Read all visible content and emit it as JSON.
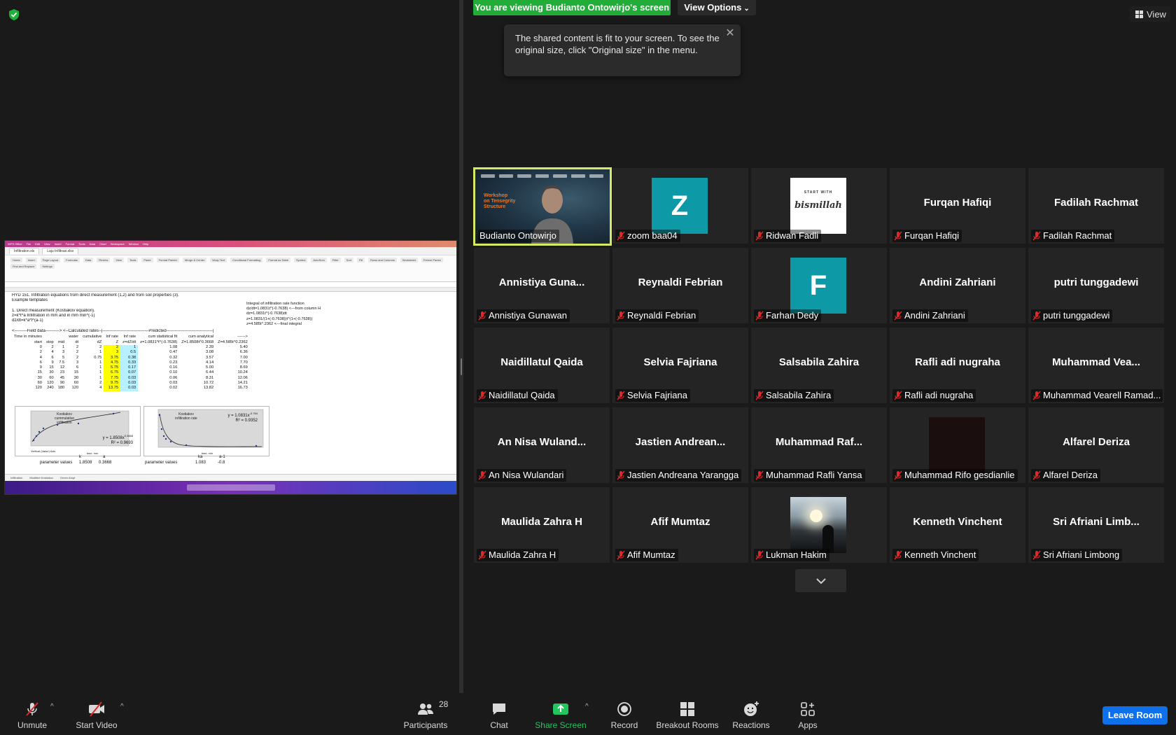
{
  "banner": {
    "viewing_text": "You are viewing Budianto Ontowirjo's screen",
    "view_options_label": "View Options"
  },
  "view_button": {
    "label": "View"
  },
  "tooltip": {
    "text": "The shared content is fit to your screen. To see the original size, click \"Original size\" in the menu."
  },
  "shared_screen": {
    "menu_items": [
      "WPS Office",
      "File",
      "Edit",
      "View",
      "Insert",
      "Format",
      "Tools",
      "Data",
      "Chart",
      "Workspace",
      "Window",
      "Help"
    ],
    "tabs": [
      "Infiltration.xls",
      "Laju Infiltrasi.xlsx"
    ],
    "ribbon_items": [
      "Home",
      "Insert",
      "Page Layout",
      "Formulas",
      "Data",
      "Review",
      "View",
      "Tools",
      "Paste",
      "Format Painter",
      "Merge & Center",
      "Wrap Text",
      "Conditional Formatting",
      "Format as Table",
      "Symbol",
      "AutoSum",
      "Filter",
      "Sort",
      "Fill",
      "Rows and Columns",
      "Worksheet",
      "Freeze Panes",
      "Find and Replace",
      "Settings"
    ],
    "lines": [
      "HYD 151. Infiltration equations from direct measurement (1,2) and from soil properties (3).",
      "Example templates",
      "",
      "1. Direct measurement (Kostiakov equation).",
      "z=k*t^a                    Infiltration in mm and in mm min^(-1)",
      "dz/dt=k*a*t^(a-1)",
      "",
      "<---------Field data---------->  <--Calculated rates--|---------------------------------Predicted---------------------------------|"
    ],
    "table_header1": [
      "Time in minutes",
      "",
      "",
      "water",
      "cumulative",
      "Inf rate",
      "Inf rate",
      "cum statistical fit",
      "cum analytical",
      "------>"
    ],
    "table_header2": [
      "start",
      "stop",
      "mid",
      "dt",
      "dZ",
      "Z",
      "z=dZ/dt",
      "z=1.0831*t^(-0.7638)",
      "Z=1.8508t^0.3668",
      "Z=4.585t^0.2362"
    ],
    "rows": [
      [
        "0",
        "2",
        "1",
        "2",
        "2",
        "2",
        "1",
        "1.08",
        "2.39",
        "5.40"
      ],
      [
        "2",
        "4",
        "3",
        "2",
        "1",
        "3",
        "0.5",
        "0.47",
        "3.08",
        "6.36"
      ],
      [
        "4",
        "6",
        "5",
        "2",
        "0.75",
        "3.75",
        "0.38",
        "0.32",
        "3.57",
        "7.00"
      ],
      [
        "6",
        "9",
        "7.5",
        "3",
        "1",
        "4.75",
        "0.33",
        "0.23",
        "4.14",
        "7.70"
      ],
      [
        "9",
        "15",
        "12",
        "6",
        "1",
        "5.75",
        "0.17",
        "0.16",
        "5.00",
        "8.69"
      ],
      [
        "15",
        "30",
        "23",
        "15",
        "1",
        "6.75",
        "0.07",
        "0.10",
        "6.44",
        "10.24"
      ],
      [
        "30",
        "60",
        "45",
        "30",
        "1",
        "7.75",
        "0.03",
        "0.06",
        "8.31",
        "12.06"
      ],
      [
        "60",
        "120",
        "90",
        "60",
        "2",
        "9.75",
        "0.03",
        "0.03",
        "10.72",
        "14.21"
      ],
      [
        "120",
        "240",
        "180",
        "120",
        "4",
        "13.75",
        "0.03",
        "0.02",
        "13.82",
        "16.73"
      ]
    ],
    "side_notes": [
      "Integral of infiltration rate function",
      "dz/dt=1.0831t^(-0.7638)  <---from column H",
      "dz=1.0831t^(-0.7638)dt",
      "z=1.0831/(1+(-0.7638))t^(1+(-0.7638))",
      "z=4.585t^.2362    <---final integral"
    ],
    "chart1": {
      "title": "Kostiakov\ncummulative\ninfiltration",
      "equation": "y = 1.8508x",
      "exponent": "0.3668",
      "r2": "R² = 0.9693",
      "xlabel": "time, min",
      "ylabel": "cumulative infiltration, mm",
      "axis_tag": "Vertical (Value) Axis"
    },
    "chart2": {
      "title": "Kostiakov\ninfiltration rate",
      "equation": "y = 1.0831x",
      "exponent": "-0.764",
      "r2": "R² = 0.9352",
      "xlabel": "time, min",
      "ylabel": "infiltration rate, mm/min"
    },
    "params": {
      "k_label": "k",
      "a_label": "a",
      "k": "1.8508",
      "a": "0.3668",
      "label1": "parameter values",
      "label2": "parameter values",
      "ka_label": "ka",
      "a1_label": "a-1",
      "ka": "1.083",
      "a1": "-0.8"
    },
    "sheet_tabs": [
      "Infiltration",
      "Modified Kostiakov",
      "Green Ampt"
    ]
  },
  "participants": [
    {
      "display": "",
      "name": "Budianto Ontowirjo",
      "type": "video-speaker",
      "muted": false
    },
    {
      "display": "Z",
      "name": "zoom baa04",
      "type": "avatar",
      "color": "#0d9aa6",
      "muted": true
    },
    {
      "display": "",
      "name": "Ridwan Fadli",
      "type": "image-bismillah",
      "img_top": "START WITH",
      "img_text": "bismillah",
      "muted": true
    },
    {
      "display": "Furqan Hafiqi",
      "name": "Furqan Hafiqi",
      "type": "text",
      "muted": true
    },
    {
      "display": "Fadilah Rachmat",
      "name": "Fadilah Rachmat",
      "type": "text",
      "muted": true
    },
    {
      "display": "Annistiya  Guna...",
      "name": "Annistiya Gunawan",
      "type": "text",
      "muted": true
    },
    {
      "display": "Reynaldi Febrian",
      "name": "Reynaldi Febrian",
      "type": "text",
      "muted": true
    },
    {
      "display": "F",
      "name": "Farhan Dedy",
      "type": "avatar",
      "color": "#0d9aa6",
      "muted": true
    },
    {
      "display": "Andini Zahriani",
      "name": "Andini Zahriani",
      "type": "text",
      "muted": true
    },
    {
      "display": "putri tunggadewi",
      "name": "putri tunggadewi",
      "type": "text",
      "muted": true
    },
    {
      "display": "Naidillatul Qaida",
      "name": "Naidillatul Qaida",
      "type": "text",
      "muted": true
    },
    {
      "display": "Selvia Fajriana",
      "name": "Selvia Fajriana",
      "type": "text",
      "muted": true
    },
    {
      "display": "Salsabila Zahira",
      "name": "Salsabila Zahira",
      "type": "text",
      "muted": true
    },
    {
      "display": "Rafli adi nugraha",
      "name": "Rafli adi nugraha",
      "type": "text",
      "muted": true
    },
    {
      "display": "Muhammad  Vea...",
      "name": "Muhammad Vearell Ramad...",
      "type": "text",
      "muted": true
    },
    {
      "display": "An  Nisa  Wuland...",
      "name": "An Nisa Wulandari",
      "type": "text",
      "muted": true
    },
    {
      "display": "Jastien  Andrean...",
      "name": "Jastien Andreana Yarangga",
      "type": "text",
      "muted": true
    },
    {
      "display": "Muhammad  Raf...",
      "name": "Muhammad Rafli Yansa",
      "type": "text",
      "muted": true
    },
    {
      "display": "",
      "name": "Muhammad Rifo gesdianlie",
      "type": "image-dark",
      "muted": true
    },
    {
      "display": "Alfarel Deriza",
      "name": "Alfarel Deriza",
      "type": "text",
      "muted": true
    },
    {
      "display": "Maulida Zahra H",
      "name": "Maulida Zahra H",
      "type": "text",
      "muted": true
    },
    {
      "display": "Afif Mumtaz",
      "name": "Afif Mumtaz",
      "type": "text",
      "muted": true
    },
    {
      "display": "",
      "name": "Lukman Hakim",
      "type": "image-sunset",
      "muted": true
    },
    {
      "display": "Kenneth Vinchent",
      "name": "Kenneth Vinchent",
      "type": "text",
      "muted": true
    },
    {
      "display": "Sri  Afriani  Limb...",
      "name": "Sri Afriani Limbong",
      "type": "text",
      "muted": true
    }
  ],
  "toolbar": {
    "unmute": "Unmute",
    "start_video": "Start Video",
    "participants": "Participants",
    "participants_count": "28",
    "chat": "Chat",
    "share_screen": "Share Screen",
    "record": "Record",
    "breakout_rooms": "Breakout Rooms",
    "reactions": "Reactions",
    "apps": "Apps",
    "leave": "Leave Room"
  },
  "colors": {
    "banner": "#22ac38",
    "active_speaker_border": "#d6e964",
    "leave": "#0e71eb",
    "share_icon": "#22c55e",
    "avatar": "#0d9aa6"
  }
}
